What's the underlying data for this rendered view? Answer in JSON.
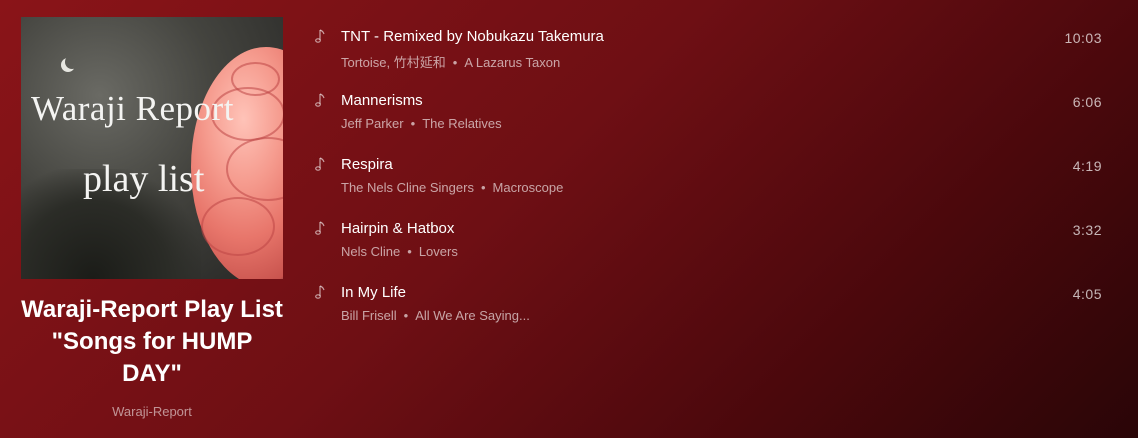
{
  "playlist": {
    "cover": {
      "line1": "Waraji Report",
      "line2": "play list"
    },
    "title": "Waraji-Report Play List \"Songs for HUMP DAY\"",
    "owner": "Waraji-Report"
  },
  "tracks": [
    {
      "name": "TNT - Remixed by Nobukazu Takemura",
      "artist": "Tortoise, 竹村延和",
      "album": "A Lazarus Taxon",
      "duration": "10:03"
    },
    {
      "name": "Mannerisms",
      "artist": "Jeff Parker",
      "album": "The Relatives",
      "duration": "6:06"
    },
    {
      "name": "Respira",
      "artist": "The Nels Cline Singers",
      "album": "Macroscope",
      "duration": "4:19"
    },
    {
      "name": "Hairpin & Hatbox",
      "artist": "Nels Cline",
      "album": "Lovers",
      "duration": "3:32"
    },
    {
      "name": "In My Life",
      "artist": "Bill Frisell",
      "album": "All We Are Saying...",
      "duration": "4:05"
    }
  ],
  "separator": "•",
  "icons": {
    "track": "music-note-icon"
  },
  "colors": {
    "background": "#6e0f14",
    "text_primary": "#ffffff"
  }
}
